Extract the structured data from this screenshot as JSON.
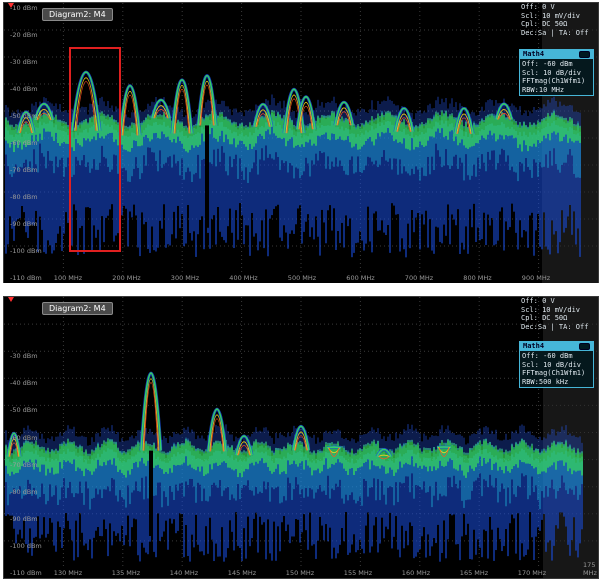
{
  "top_panel": {
    "diagram_title": "Diagram2: M4",
    "y_labels": [
      "-10 dBm",
      "-20 dBm",
      "-30 dBm",
      "-40 dBm",
      "-50 dBm",
      "-60 dBm",
      "-70 dBm",
      "-80 dBm",
      "-90 dBm",
      "-100 dBm",
      "-110 dBm"
    ],
    "x_labels": [
      "100 MHz",
      "200 MHz",
      "300 MHz",
      "400 MHz",
      "500 MHz",
      "600 MHz",
      "700 MHz",
      "800 MHz",
      "900 MHz"
    ],
    "channel_info": [
      "Off: 0 V",
      "Scl: 10 mV/div",
      "Cpl: DC 50Ω",
      "Dec:Sa | TA: Off"
    ],
    "math_title": "Math4",
    "math_info": [
      "Off:  -60 dBm",
      "Scl:  10 dB/div",
      "FFTmag(Ch1Wfm1)",
      "RBW:10 MHz"
    ]
  },
  "bottom_panel": {
    "diagram_title": "Diagram2: M4",
    "y_labels": [
      "",
      "",
      "-30 dBm",
      "-40 dBm",
      "-50 dBm",
      "-60 dBm",
      "-70 dBm",
      "-80 dBm",
      "-90 dBm",
      "-100 dBm",
      "-110 dBm"
    ],
    "x_labels": [
      "130 MHz",
      "135 MHz",
      "140 MHz",
      "145 MHz",
      "150 MHz",
      "155 MHz",
      "160 MHz",
      "165 MHz",
      "170 MHz",
      "175 MHz"
    ],
    "channel_info": [
      "Off: 0 V",
      "Scl: 10 mV/div",
      "Cpl: DC 50Ω",
      "Dec:Sa | TA: Off"
    ],
    "math_title": "Math4",
    "math_info": [
      "Off:  -60 dBm",
      "Scl:  10 dB/div",
      "FFTmag(Ch1Wfm1)",
      "RBW:500 kHz"
    ]
  },
  "colors": {
    "trace_cyan": "#46b6d8",
    "highlight_red": "#e02020",
    "spectrum_green": "#39e05a",
    "spectrum_blue": "#1a4fe0"
  }
}
